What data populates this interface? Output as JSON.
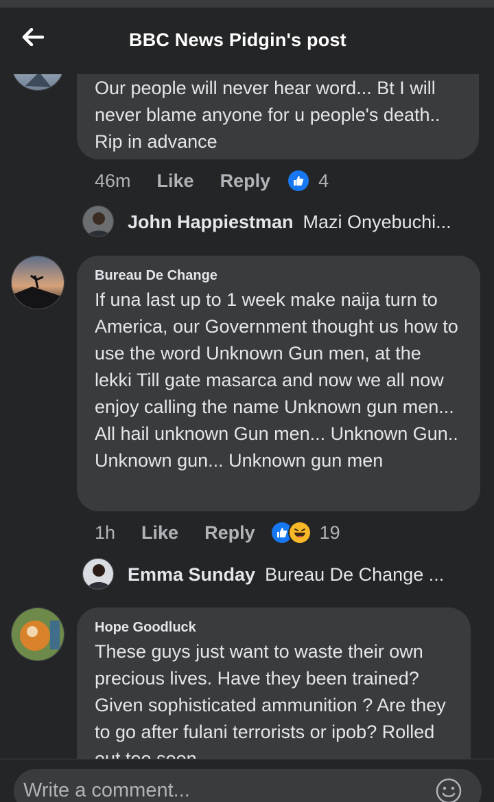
{
  "header": {
    "title": "BBC News Pidgin's post",
    "back_icon": "arrow-left-icon"
  },
  "comments": [
    {
      "author": "",
      "text": "Our people will never hear word... Bt I will never blame anyone for u people's death.. Rip in advance",
      "time": "46m",
      "like_label": "Like",
      "reply_label": "Reply",
      "reactions": [
        "like"
      ],
      "reaction_count": "4",
      "reply_preview": {
        "name": "John Happiestman",
        "text": "Mazi Onyebuchi..."
      }
    },
    {
      "author": "Bureau De Change",
      "text": "If una last up to 1 week make naija turn to America,  our Government thought us how to use the word  Unknown Gun men, at the lekki Till gate masarca and now we all now enjoy calling the name Unknown gun men... All hail unknown Gun men... Unknown Gun.. Unknown gun... Unknown gun men",
      "time": "1h",
      "like_label": "Like",
      "reply_label": "Reply",
      "reactions": [
        "like",
        "haha"
      ],
      "reaction_count": "19",
      "reply_preview": {
        "name": "Emma Sunday",
        "text": "Bureau De Change ..."
      }
    },
    {
      "author": "Hope Goodluck",
      "text": "These guys just want to waste  their own precious lives. Have they been trained? Given sophisticated ammunition ? Are they to go after fulani terrorists or ipob? Rolled out too soon."
    }
  ],
  "composer": {
    "placeholder": "Write a comment...",
    "emoji_icon": "smiley-icon"
  },
  "colors": {
    "background": "#242526",
    "bubble": "#3a3b3c",
    "text": "#e4e6eb",
    "secondary_text": "#b0b3b8",
    "like_blue": "#1877f2",
    "haha_yellow": "#f7b928"
  }
}
